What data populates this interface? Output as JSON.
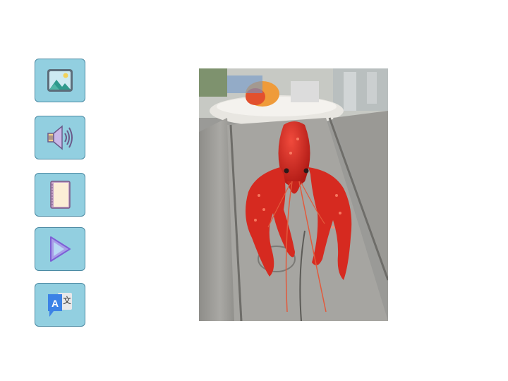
{
  "toolbar": {
    "buttons": [
      {
        "id": "image",
        "icon": "image-icon"
      },
      {
        "id": "audio",
        "icon": "speaker-icon"
      },
      {
        "id": "book",
        "icon": "book-icon"
      },
      {
        "id": "play",
        "icon": "play-icon"
      },
      {
        "id": "translate",
        "icon": "translate-icon",
        "glyph_a": "A",
        "glyph_b": "文"
      }
    ],
    "colors": {
      "button_fill": "#92cfe0",
      "button_border": "#4d8aa3"
    }
  },
  "main_image": {
    "subject": "crayfish-photo",
    "colors": {
      "crayfish": "#d42a22",
      "wood": "#9c9b97"
    }
  }
}
